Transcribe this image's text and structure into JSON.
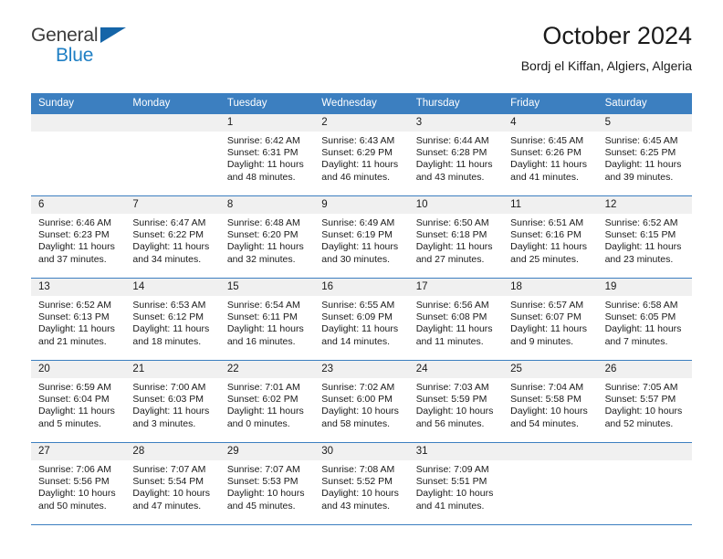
{
  "logo": {
    "line1": "General",
    "line2": "Blue",
    "flag_icon": "blue-triangle-flag-icon"
  },
  "header": {
    "title": "October 2024",
    "subtitle": "Bordj el Kiffan, Algiers, Algeria"
  },
  "colors": {
    "header_blue": "#3c7fc0",
    "logo_blue": "#1f7fc4",
    "day_number_band": "#f0f0f0"
  },
  "weekdays": [
    "Sunday",
    "Monday",
    "Tuesday",
    "Wednesday",
    "Thursday",
    "Friday",
    "Saturday"
  ],
  "weeks": [
    [
      {
        "day": "",
        "empty": true
      },
      {
        "day": "",
        "empty": true
      },
      {
        "day": "1",
        "sunrise": "Sunrise: 6:42 AM",
        "sunset": "Sunset: 6:31 PM",
        "daylight1": "Daylight: 11 hours",
        "daylight2": "and 48 minutes."
      },
      {
        "day": "2",
        "sunrise": "Sunrise: 6:43 AM",
        "sunset": "Sunset: 6:29 PM",
        "daylight1": "Daylight: 11 hours",
        "daylight2": "and 46 minutes."
      },
      {
        "day": "3",
        "sunrise": "Sunrise: 6:44 AM",
        "sunset": "Sunset: 6:28 PM",
        "daylight1": "Daylight: 11 hours",
        "daylight2": "and 43 minutes."
      },
      {
        "day": "4",
        "sunrise": "Sunrise: 6:45 AM",
        "sunset": "Sunset: 6:26 PM",
        "daylight1": "Daylight: 11 hours",
        "daylight2": "and 41 minutes."
      },
      {
        "day": "5",
        "sunrise": "Sunrise: 6:45 AM",
        "sunset": "Sunset: 6:25 PM",
        "daylight1": "Daylight: 11 hours",
        "daylight2": "and 39 minutes."
      }
    ],
    [
      {
        "day": "6",
        "sunrise": "Sunrise: 6:46 AM",
        "sunset": "Sunset: 6:23 PM",
        "daylight1": "Daylight: 11 hours",
        "daylight2": "and 37 minutes."
      },
      {
        "day": "7",
        "sunrise": "Sunrise: 6:47 AM",
        "sunset": "Sunset: 6:22 PM",
        "daylight1": "Daylight: 11 hours",
        "daylight2": "and 34 minutes."
      },
      {
        "day": "8",
        "sunrise": "Sunrise: 6:48 AM",
        "sunset": "Sunset: 6:20 PM",
        "daylight1": "Daylight: 11 hours",
        "daylight2": "and 32 minutes."
      },
      {
        "day": "9",
        "sunrise": "Sunrise: 6:49 AM",
        "sunset": "Sunset: 6:19 PM",
        "daylight1": "Daylight: 11 hours",
        "daylight2": "and 30 minutes."
      },
      {
        "day": "10",
        "sunrise": "Sunrise: 6:50 AM",
        "sunset": "Sunset: 6:18 PM",
        "daylight1": "Daylight: 11 hours",
        "daylight2": "and 27 minutes."
      },
      {
        "day": "11",
        "sunrise": "Sunrise: 6:51 AM",
        "sunset": "Sunset: 6:16 PM",
        "daylight1": "Daylight: 11 hours",
        "daylight2": "and 25 minutes."
      },
      {
        "day": "12",
        "sunrise": "Sunrise: 6:52 AM",
        "sunset": "Sunset: 6:15 PM",
        "daylight1": "Daylight: 11 hours",
        "daylight2": "and 23 minutes."
      }
    ],
    [
      {
        "day": "13",
        "sunrise": "Sunrise: 6:52 AM",
        "sunset": "Sunset: 6:13 PM",
        "daylight1": "Daylight: 11 hours",
        "daylight2": "and 21 minutes."
      },
      {
        "day": "14",
        "sunrise": "Sunrise: 6:53 AM",
        "sunset": "Sunset: 6:12 PM",
        "daylight1": "Daylight: 11 hours",
        "daylight2": "and 18 minutes."
      },
      {
        "day": "15",
        "sunrise": "Sunrise: 6:54 AM",
        "sunset": "Sunset: 6:11 PM",
        "daylight1": "Daylight: 11 hours",
        "daylight2": "and 16 minutes."
      },
      {
        "day": "16",
        "sunrise": "Sunrise: 6:55 AM",
        "sunset": "Sunset: 6:09 PM",
        "daylight1": "Daylight: 11 hours",
        "daylight2": "and 14 minutes."
      },
      {
        "day": "17",
        "sunrise": "Sunrise: 6:56 AM",
        "sunset": "Sunset: 6:08 PM",
        "daylight1": "Daylight: 11 hours",
        "daylight2": "and 11 minutes."
      },
      {
        "day": "18",
        "sunrise": "Sunrise: 6:57 AM",
        "sunset": "Sunset: 6:07 PM",
        "daylight1": "Daylight: 11 hours",
        "daylight2": "and 9 minutes."
      },
      {
        "day": "19",
        "sunrise": "Sunrise: 6:58 AM",
        "sunset": "Sunset: 6:05 PM",
        "daylight1": "Daylight: 11 hours",
        "daylight2": "and 7 minutes."
      }
    ],
    [
      {
        "day": "20",
        "sunrise": "Sunrise: 6:59 AM",
        "sunset": "Sunset: 6:04 PM",
        "daylight1": "Daylight: 11 hours",
        "daylight2": "and 5 minutes."
      },
      {
        "day": "21",
        "sunrise": "Sunrise: 7:00 AM",
        "sunset": "Sunset: 6:03 PM",
        "daylight1": "Daylight: 11 hours",
        "daylight2": "and 3 minutes."
      },
      {
        "day": "22",
        "sunrise": "Sunrise: 7:01 AM",
        "sunset": "Sunset: 6:02 PM",
        "daylight1": "Daylight: 11 hours",
        "daylight2": "and 0 minutes."
      },
      {
        "day": "23",
        "sunrise": "Sunrise: 7:02 AM",
        "sunset": "Sunset: 6:00 PM",
        "daylight1": "Daylight: 10 hours",
        "daylight2": "and 58 minutes."
      },
      {
        "day": "24",
        "sunrise": "Sunrise: 7:03 AM",
        "sunset": "Sunset: 5:59 PM",
        "daylight1": "Daylight: 10 hours",
        "daylight2": "and 56 minutes."
      },
      {
        "day": "25",
        "sunrise": "Sunrise: 7:04 AM",
        "sunset": "Sunset: 5:58 PM",
        "daylight1": "Daylight: 10 hours",
        "daylight2": "and 54 minutes."
      },
      {
        "day": "26",
        "sunrise": "Sunrise: 7:05 AM",
        "sunset": "Sunset: 5:57 PM",
        "daylight1": "Daylight: 10 hours",
        "daylight2": "and 52 minutes."
      }
    ],
    [
      {
        "day": "27",
        "sunrise": "Sunrise: 7:06 AM",
        "sunset": "Sunset: 5:56 PM",
        "daylight1": "Daylight: 10 hours",
        "daylight2": "and 50 minutes."
      },
      {
        "day": "28",
        "sunrise": "Sunrise: 7:07 AM",
        "sunset": "Sunset: 5:54 PM",
        "daylight1": "Daylight: 10 hours",
        "daylight2": "and 47 minutes."
      },
      {
        "day": "29",
        "sunrise": "Sunrise: 7:07 AM",
        "sunset": "Sunset: 5:53 PM",
        "daylight1": "Daylight: 10 hours",
        "daylight2": "and 45 minutes."
      },
      {
        "day": "30",
        "sunrise": "Sunrise: 7:08 AM",
        "sunset": "Sunset: 5:52 PM",
        "daylight1": "Daylight: 10 hours",
        "daylight2": "and 43 minutes."
      },
      {
        "day": "31",
        "sunrise": "Sunrise: 7:09 AM",
        "sunset": "Sunset: 5:51 PM",
        "daylight1": "Daylight: 10 hours",
        "daylight2": "and 41 minutes."
      },
      {
        "day": "",
        "empty": true
      },
      {
        "day": "",
        "empty": true
      }
    ]
  ]
}
